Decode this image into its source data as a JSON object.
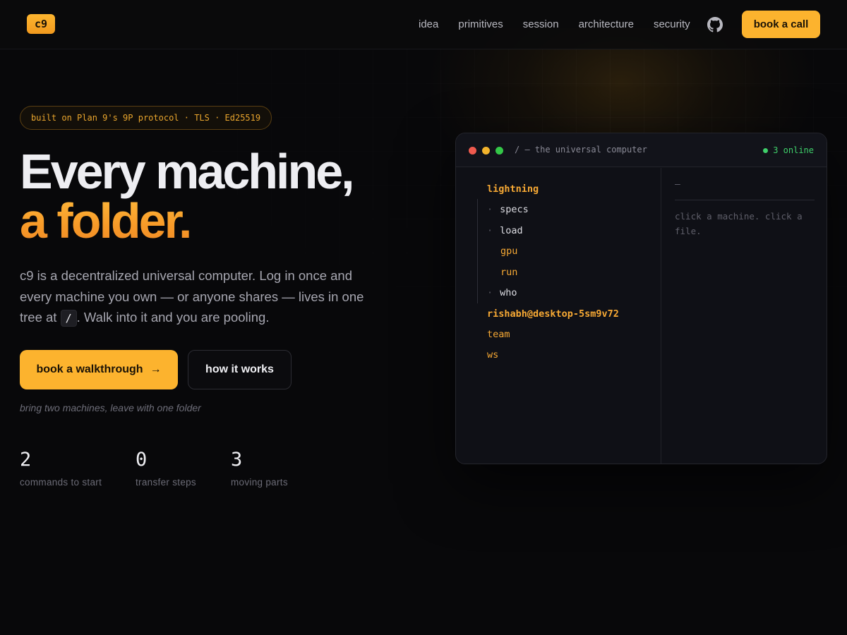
{
  "brand": {
    "logo": "c9"
  },
  "nav": {
    "links": [
      "idea",
      "primitives",
      "session",
      "architecture",
      "security"
    ],
    "github_icon": "github-icon",
    "cta": "book a call"
  },
  "hero": {
    "pill": "built on Plan 9's 9P protocol · TLS · Ed25519",
    "title_line1": "Every machine,",
    "title_line2": "a folder.",
    "lede_before": "c9 is a decentralized universal computer. Log in once and every machine you own — or anyone shares — lives in one tree at ",
    "lede_code": "/",
    "lede_after": ". Walk into it and you are pooling.",
    "primary_button": "book a walkthrough",
    "primary_arrow": "→",
    "secondary_button": "how it works",
    "tagline": "bring two machines, leave with one folder",
    "stats": [
      {
        "value": "2",
        "label": "commands to start"
      },
      {
        "value": "0",
        "label": "transfer steps"
      },
      {
        "value": "3",
        "label": "moving parts"
      }
    ]
  },
  "terminal": {
    "title": "/ — the universal computer",
    "online": "3 online",
    "tree": [
      {
        "label": "lightning",
        "kind": "folder"
      },
      {
        "label": "specs",
        "kind": "file",
        "bullet": "·"
      },
      {
        "label": "load",
        "kind": "file",
        "bullet": "·"
      },
      {
        "label": "gpu",
        "kind": "sub"
      },
      {
        "label": "run",
        "kind": "sub"
      },
      {
        "label": "who",
        "kind": "file",
        "bullet": "·"
      },
      {
        "label": "rishabh@desktop-5sm9v72",
        "kind": "folder"
      },
      {
        "label": "team",
        "kind": "sub"
      },
      {
        "label": "ws",
        "kind": "sub"
      }
    ],
    "pane_header": "—",
    "pane_hint": "click a machine. click a file.",
    "colors": {
      "red": "#ef5a4e",
      "yellow": "#f2b32c",
      "green": "#34c748"
    }
  },
  "colors": {
    "accent": "#fcb32e",
    "background": "#08080a",
    "online": "#3fcf6a"
  }
}
